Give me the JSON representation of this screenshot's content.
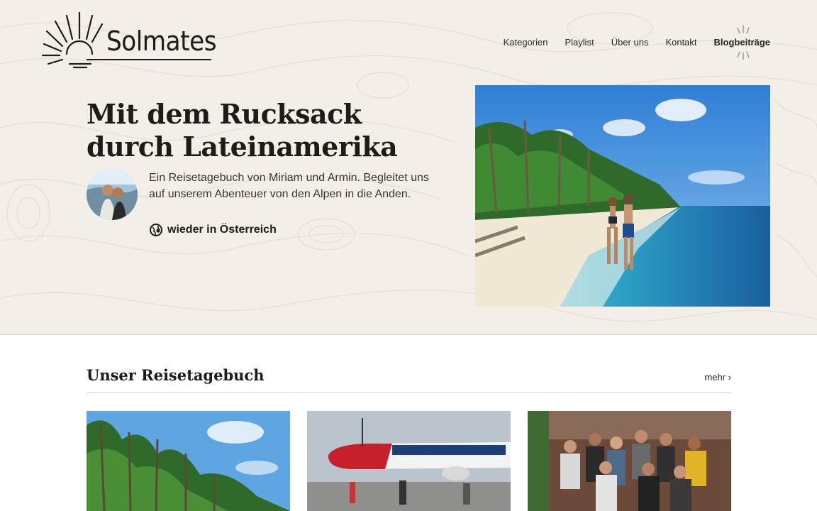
{
  "brand": {
    "name": "Solmates"
  },
  "nav": {
    "items": [
      {
        "label": "Kategorien"
      },
      {
        "label": "Playlist"
      },
      {
        "label": "Über uns"
      },
      {
        "label": "Kontakt"
      },
      {
        "label": "Blogbeiträge"
      }
    ]
  },
  "hero": {
    "title": "Mit dem Rucksack durch Lateinamerika",
    "intro": "Ein Reisetagebuch von Miriam und Armin. Begleitet uns auf unserem Abenteuer von den Alpen in die Anden.",
    "location": "wieder in Österreich",
    "icons": {
      "location": "globe-pin-icon",
      "logo": "sun-icon"
    }
  },
  "diary": {
    "title": "Unser Reisetagebuch",
    "more": "mehr ›"
  },
  "colors": {
    "background": "#f3efe8",
    "text": "#1e1b18",
    "accent": "#1e1b18"
  }
}
